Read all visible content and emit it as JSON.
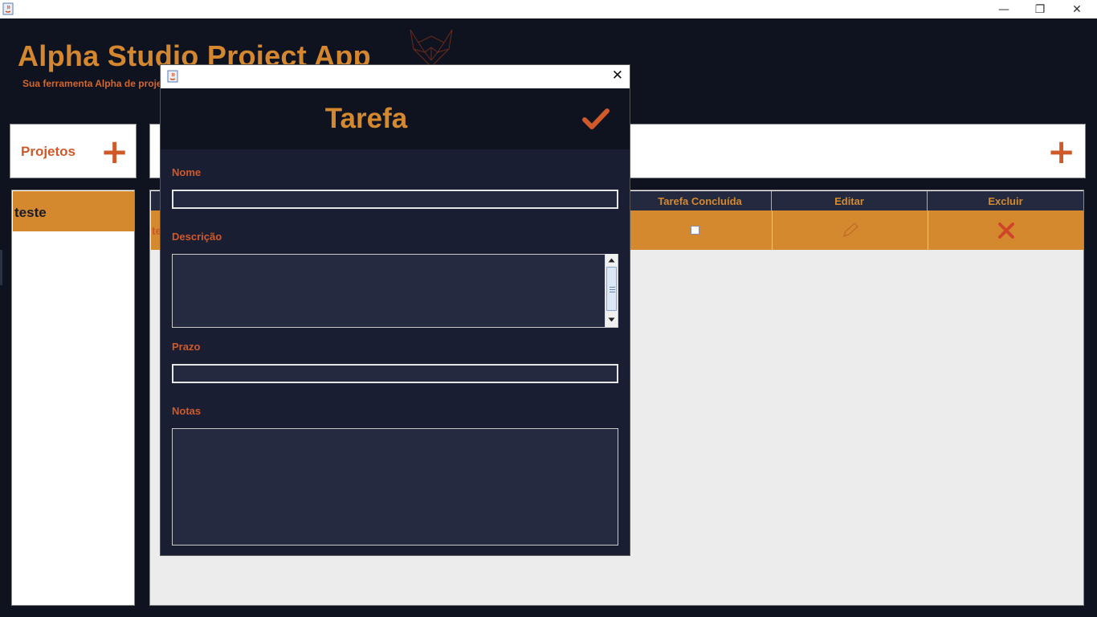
{
  "os_window": {
    "controls": {
      "minimize": "—",
      "maximize": "❐",
      "close": "✕"
    }
  },
  "app": {
    "title": "Alpha Studio Project App",
    "subtitle": "Sua ferramenta Alpha de proje"
  },
  "projects_panel": {
    "label": "Projetos",
    "add_icon": "plus-icon",
    "items": [
      {
        "name": "teste",
        "selected": true
      }
    ]
  },
  "tasks_panel": {
    "add_icon": "plus-icon",
    "columns": [
      "Tarefa Concluída",
      "Editar",
      "Excluir"
    ],
    "rows": [
      {
        "name_fragment": "te",
        "completed": false,
        "edit_icon": "pencil-icon",
        "delete_icon": "x-icon"
      }
    ]
  },
  "dialog": {
    "heading": "Tarefa",
    "close": "✕",
    "confirm_icon": "checkmark-icon",
    "fields": {
      "nome": {
        "label": "Nome",
        "value": ""
      },
      "descricao": {
        "label": "Descrição",
        "value": ""
      },
      "prazo": {
        "label": "Prazo",
        "value": ""
      },
      "notas": {
        "label": "Notas",
        "value": ""
      }
    }
  },
  "colors": {
    "dark_bg": "#0f1320",
    "dialog_bg": "#191e33",
    "accent_orange": "#d4892f",
    "accent_red": "#d0592a",
    "table_header": "#232a3f"
  }
}
